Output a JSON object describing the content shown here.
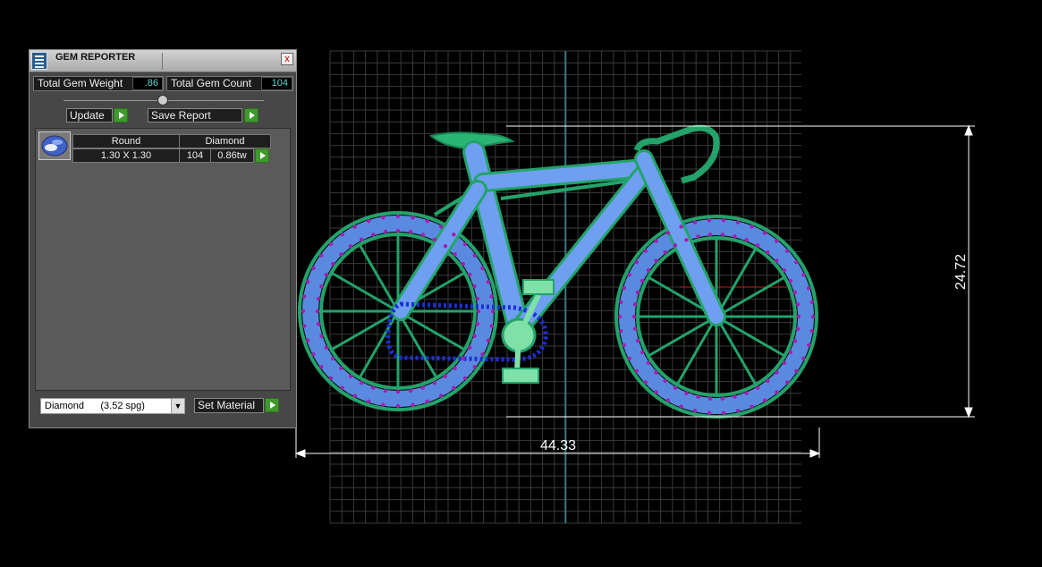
{
  "panel": {
    "title": "GEM REPORTER",
    "close_glyph": "x",
    "total_gem_weight_label": "Total Gem Weight",
    "total_gem_weight_value": ".86",
    "total_gem_count_label": "Total Gem Count",
    "total_gem_count_value": "104",
    "update_label": "Update",
    "save_report_label": "Save Report",
    "gem_row": {
      "shape": "Round",
      "material": "Diamond",
      "size": "1.30 X 1.30",
      "count": "104",
      "weight": "0.86tw"
    },
    "material_select_value": "Diamond      (3.52 spg)",
    "set_material_label": "Set Material"
  },
  "viewport": {
    "width_dimension": "44.33",
    "height_dimension": "24.72"
  },
  "colors": {
    "frame_green": "#23a36a",
    "gem_blue": "#5a8ae0",
    "prong_purple": "#a020b0",
    "chain_blue": "#1c2fd6",
    "grid_line": "#3a3a3a",
    "axis_cyan": "#3ab7c9"
  },
  "icons": {
    "app": "gem-reporter-icon",
    "close": "close-icon",
    "play": "play-arrow-icon",
    "gem": "round-gem-icon",
    "dropdown": "chevron-down-icon"
  }
}
